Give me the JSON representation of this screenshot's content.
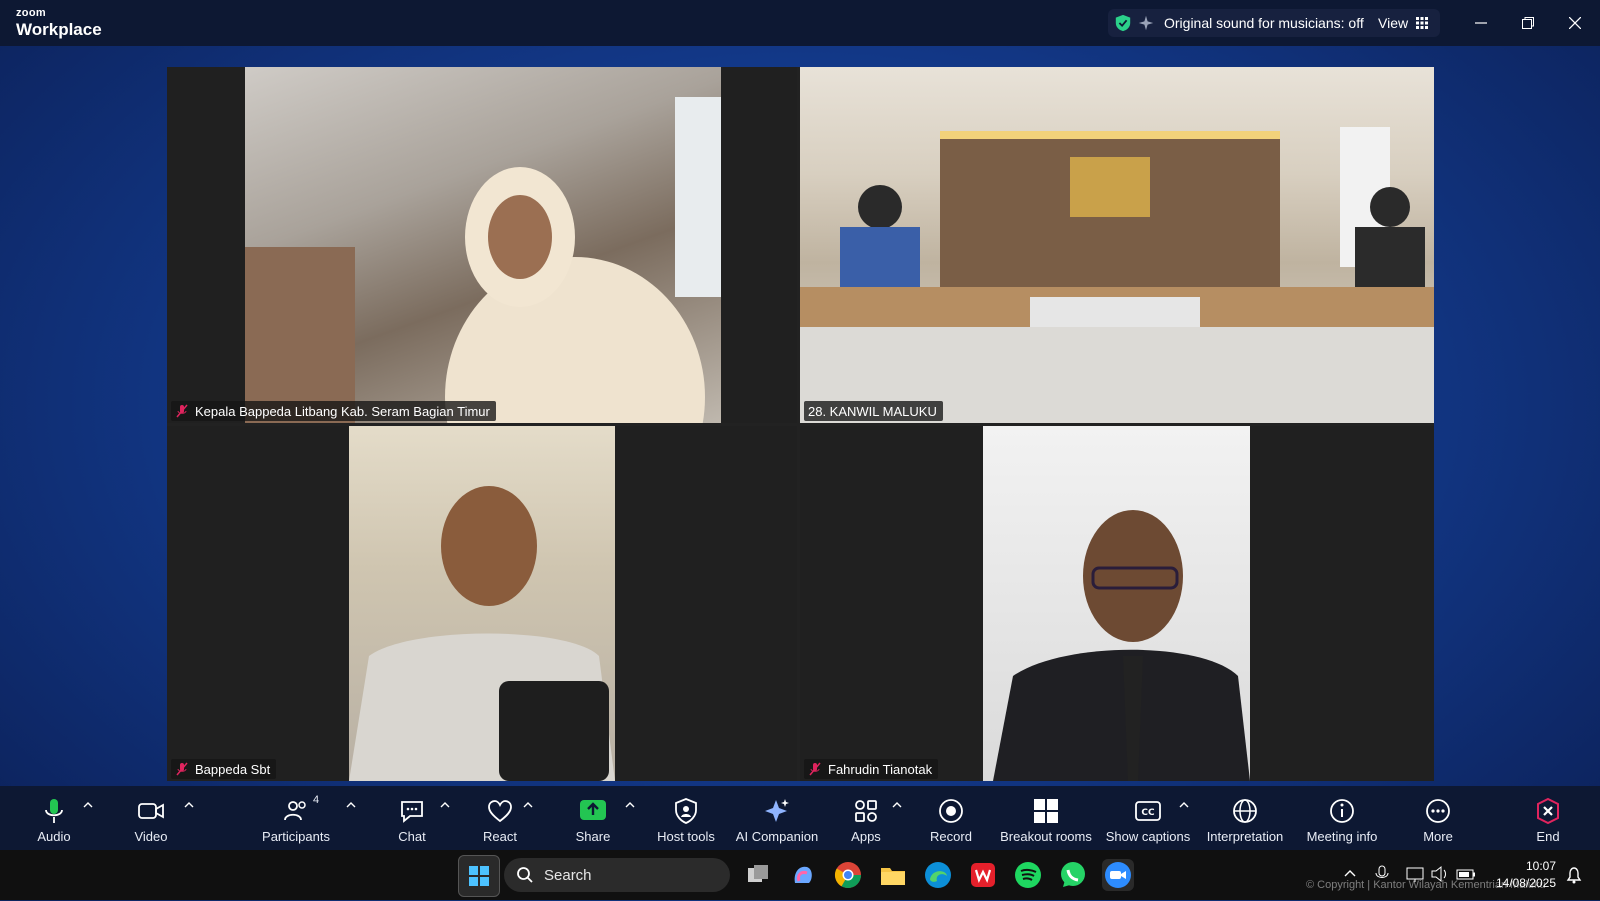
{
  "app": {
    "brand_small": "zoom",
    "brand_big": "Workplace"
  },
  "topbar": {
    "sound_text": "Original sound for musicians: off",
    "view_label": "View"
  },
  "tiles": [
    {
      "name": "Kepala Bappeda Litbang Kab. Seram Bagian Timur",
      "muted": true
    },
    {
      "name": "28. KANWIL MALUKU",
      "muted": false,
      "active": true
    },
    {
      "name": "Bappeda Sbt",
      "muted": true
    },
    {
      "name": "Fahrudin Tianotak",
      "muted": true
    }
  ],
  "toolbar": {
    "audio": "Audio",
    "video": "Video",
    "participants": "Participants",
    "participants_count": "4",
    "chat": "Chat",
    "react": "React",
    "share": "Share",
    "host_tools": "Host tools",
    "ai_companion": "AI Companion",
    "apps": "Apps",
    "record": "Record",
    "breakout_rooms": "Breakout rooms",
    "show_captions": "Show captions",
    "interpretation": "Interpretation",
    "meeting_info": "Meeting info",
    "more": "More",
    "end": "End"
  },
  "taskbar": {
    "search_placeholder": "Search",
    "time": "10:07",
    "date": "14/08/2025"
  },
  "watermark": "© Copyright | Kantor Wilayah Kementrian Maluku",
  "colors": {
    "share_green": "#23c552",
    "active_outline": "#2bd18a",
    "end_red": "#e0245e"
  }
}
